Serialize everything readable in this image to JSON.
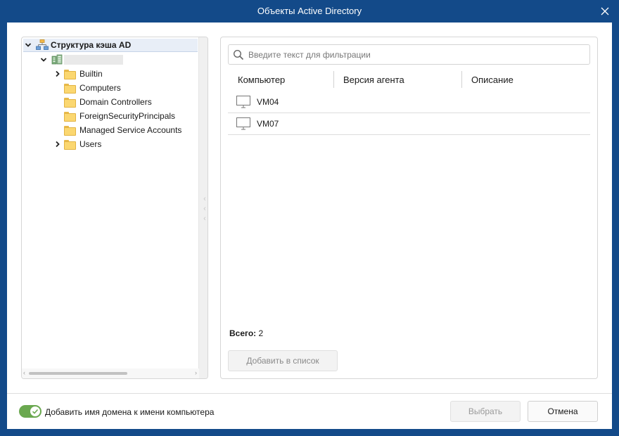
{
  "window": {
    "title": "Объекты Active Directory"
  },
  "tree": {
    "root_label": "Структура кэша AD",
    "domain_label": "",
    "folders": [
      {
        "label": "Builtin",
        "expandable": true
      },
      {
        "label": "Computers",
        "expandable": false
      },
      {
        "label": "Domain Controllers",
        "expandable": false
      },
      {
        "label": "ForeignSecurityPrincipals",
        "expandable": false
      },
      {
        "label": "Managed Service Accounts",
        "expandable": false
      },
      {
        "label": "Users",
        "expandable": true
      }
    ]
  },
  "filter": {
    "placeholder": "Введите текст для фильтрации",
    "value": ""
  },
  "table": {
    "columns": [
      "Компьютер",
      "Версия агента",
      "Описание"
    ],
    "rows": [
      {
        "computer": "VM04",
        "agent_version": "",
        "description": ""
      },
      {
        "computer": "VM07",
        "agent_version": "",
        "description": ""
      }
    ]
  },
  "summary": {
    "total_label": "Всего:",
    "total_value": "2"
  },
  "buttons": {
    "add_to_list": "Добавить в список",
    "select": "Выбрать",
    "cancel": "Отмена"
  },
  "options": {
    "add_domain_toggle_label": "Добавить имя домена к имени компьютера",
    "add_domain_enabled": true
  },
  "colors": {
    "title_bar": "#134a89",
    "toggle_on": "#6aa84f",
    "folder": "#fbd770"
  }
}
